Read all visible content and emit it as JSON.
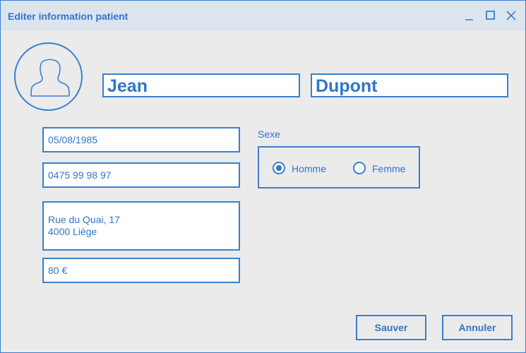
{
  "window": {
    "title": "Editer information patient",
    "accent_color": "#3a7fcf",
    "text_color": "#2f76c9",
    "controls": [
      "minimize-icon",
      "maximize-icon",
      "close-icon"
    ]
  },
  "patient": {
    "avatar_icon": "user-silhouette-icon",
    "first_name": "Jean",
    "last_name": "Dupont",
    "birth_date": "05/08/1985",
    "phone": "0475 99 98 97",
    "address_line1": "Rue du Quai, 17",
    "address_line2": "4000 Liège",
    "price": "80 €"
  },
  "sex": {
    "label": "Sexe",
    "options": [
      {
        "label": "Homme",
        "selected": true
      },
      {
        "label": "Femme",
        "selected": false
      }
    ]
  },
  "actions": {
    "save_label": "Sauver",
    "cancel_label": "Annuler"
  }
}
